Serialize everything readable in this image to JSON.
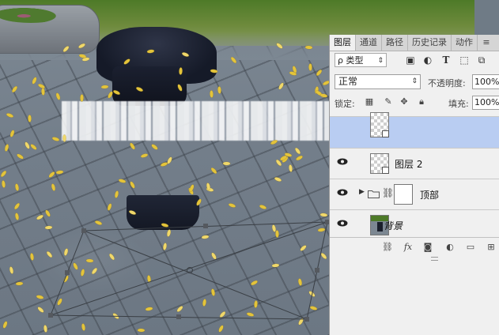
{
  "panel": {
    "tabs": [
      {
        "label": "图层",
        "active": true
      },
      {
        "label": "通道",
        "active": false
      },
      {
        "label": "路径",
        "active": false
      },
      {
        "label": "历史记录",
        "active": false
      },
      {
        "label": "动作",
        "active": false
      }
    ],
    "filter": {
      "label": "ρ 类型",
      "arrow": "⇕"
    },
    "filter_icons": [
      "image-filter-icon",
      "adjustment-filter-icon",
      "type-filter-icon",
      "shape-filter-icon",
      "smart-object-filter-icon"
    ],
    "blend_mode": {
      "value": "正常",
      "arrow": "⇕"
    },
    "opacity": {
      "label": "不透明度:",
      "value": "100%"
    },
    "lock": {
      "label": "锁定:",
      "icons": [
        "lock-transparent-icon",
        "lock-paint-icon",
        "lock-move-icon",
        "lock-all-icon"
      ]
    },
    "fill": {
      "label": "填充:",
      "value": "100%"
    },
    "layers": [
      {
        "name": "",
        "selected": true,
        "type": "smart-object",
        "visible": false
      },
      {
        "name": "图层 2",
        "selected": false,
        "type": "smart-object",
        "visible": true
      },
      {
        "name": "顶部",
        "selected": false,
        "type": "group",
        "visible": true
      },
      {
        "name": "背景",
        "selected": false,
        "type": "background",
        "visible": true
      }
    ],
    "footer_icons": [
      "link-layers-icon",
      "fx-icon",
      "add-mask-icon",
      "adjustment-layer-icon",
      "new-group-icon",
      "new-layer-icon"
    ],
    "footer_labels": {
      "fx": "fx"
    }
  },
  "colors": {
    "selection": "#b9cdf2",
    "panel_bg": "#f0f0f0",
    "tab_bar": "#d5d5d5"
  }
}
